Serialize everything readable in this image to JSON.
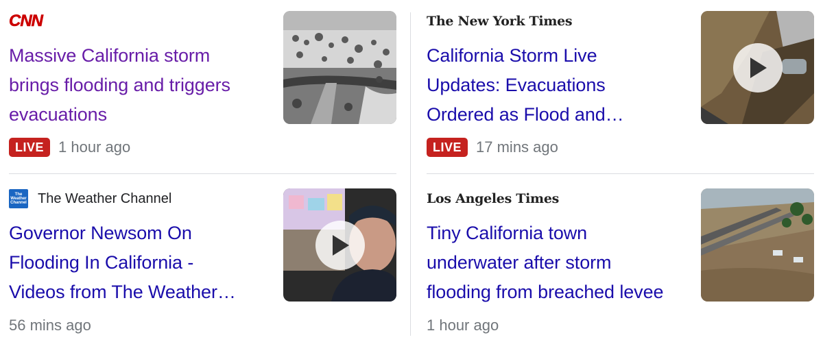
{
  "cards": [
    {
      "source": "CNN",
      "headline_lines": [
        "Massive California storm",
        "brings flooding and triggers",
        "evacuations"
      ],
      "live_label": "LIVE",
      "time": "1 hour ago",
      "thumbnail_icon": "flooded-farmland-photo"
    },
    {
      "source": "The New York Times",
      "headline_lines": [
        "California Storm Live",
        "Updates: Evacuations",
        "Ordered as Flood and…"
      ],
      "live_label": "LIVE",
      "time": "17 mins ago",
      "thumbnail_icon": "landslide-video-thumbnail"
    },
    {
      "source": "The Weather Channel",
      "source_logo_text": [
        "The",
        "Weather",
        "Channel"
      ],
      "headline_lines": [
        "Governor Newsom On",
        "Flooding In California -",
        "Videos from The Weather…"
      ],
      "time": "56 mins ago",
      "thumbnail_icon": "governor-video-thumbnail"
    },
    {
      "source": "Los Angeles Times",
      "headline_lines": [
        "Tiny California town",
        "underwater after storm",
        "flooding from breached levee"
      ],
      "time": "1 hour ago",
      "thumbnail_icon": "flooded-town-photo"
    }
  ],
  "colors": {
    "visited_link": "#681da8",
    "link": "#1a0dab",
    "live_badge": "#c5221f",
    "timestamp": "#70757a",
    "cnn_red": "#cc0000"
  }
}
